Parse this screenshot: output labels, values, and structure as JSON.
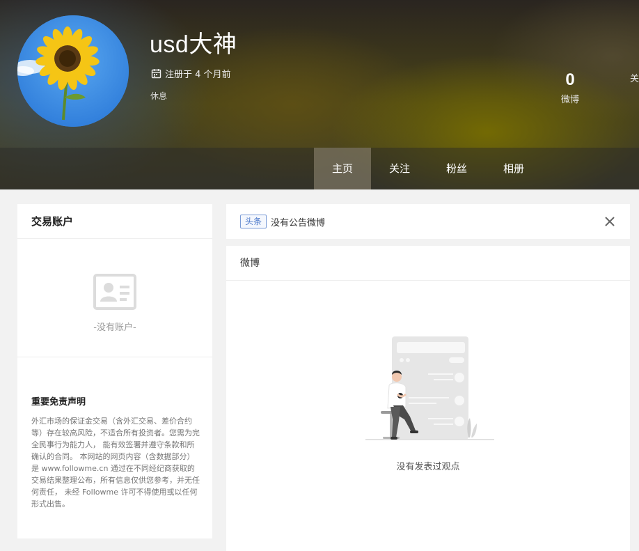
{
  "profile": {
    "username": "usd大神",
    "register_text": "注册于 4 个月前",
    "status": "休息"
  },
  "stats": [
    {
      "value": "0",
      "label": "微博"
    },
    {
      "value": "",
      "label": "关"
    }
  ],
  "tabs": [
    "主页",
    "关注",
    "粉丝",
    "相册"
  ],
  "left_card": {
    "title": "交易账户",
    "empty_text": "-没有账户-",
    "disclaimer_title": "重要免责声明",
    "disclaimer_body": "外汇市场的保证金交易（含外汇交易、差价合约等）存在较高风险，不适合所有投资者。您需为完全民事行为能力人， 能有效签署并遵守条款和所确认的合同。 本网站的网页内容（含数据部分）是 www.followme.cn 通过在不同经纪商获取的交易结果整理公布，所有信息仅供您参考，并无任何责任， 未经 Followme 许可不得使用或以任何形式出售。"
  },
  "notice": {
    "tag": "头条",
    "text": "没有公告微博"
  },
  "weibo_panel": {
    "title": "微博",
    "empty_text": "没有发表过观点"
  },
  "colors": {
    "accent_tag": "#4a77c9",
    "page_bg": "#f2f2f2"
  },
  "icons": {
    "register": "calendar-icon",
    "account_empty": "id-card-icon",
    "notice_close": "close-icon"
  }
}
